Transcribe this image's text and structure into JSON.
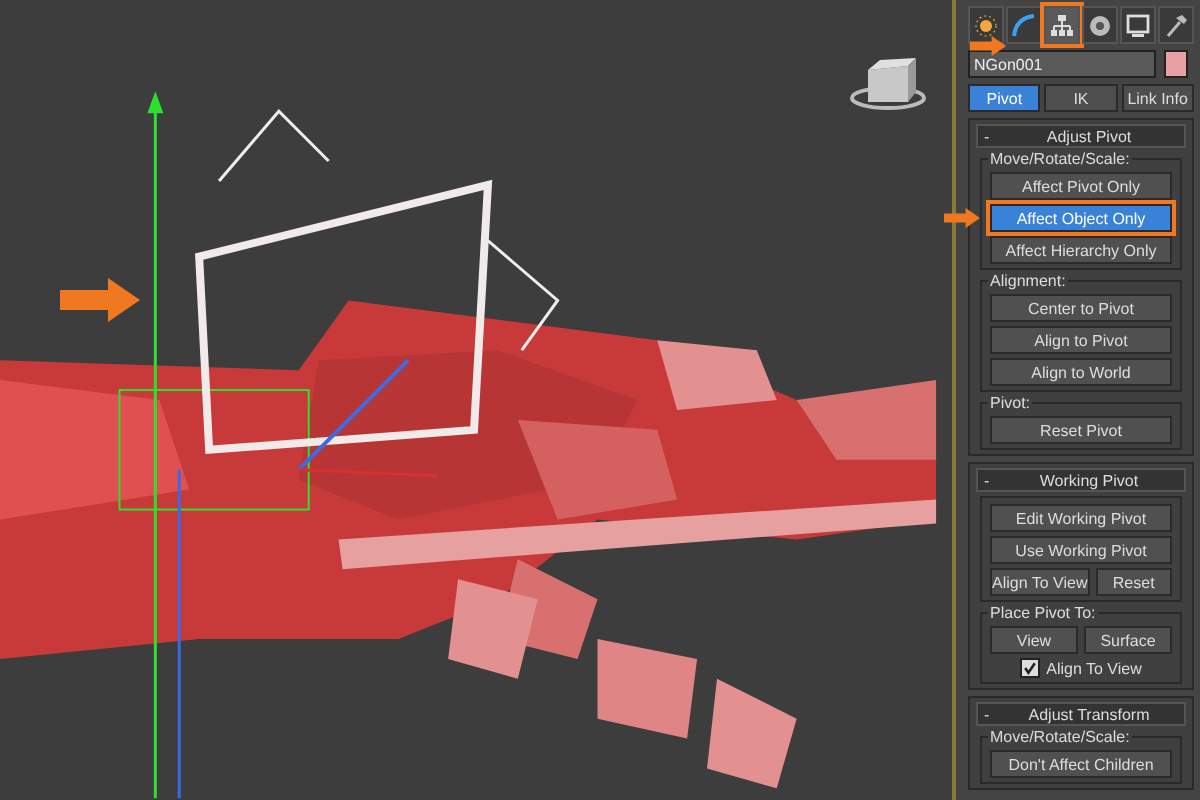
{
  "command_tabs": [
    {
      "kind": "light",
      "selected": false,
      "highlighted": false
    },
    {
      "kind": "curve",
      "selected": false,
      "highlighted": false
    },
    {
      "kind": "hierarchy",
      "selected": true,
      "highlighted": true
    },
    {
      "kind": "motion",
      "selected": false,
      "highlighted": false
    },
    {
      "kind": "display",
      "selected": false,
      "highlighted": false
    },
    {
      "kind": "hammer",
      "selected": false,
      "highlighted": false
    }
  ],
  "object_name": {
    "value": "NGon001",
    "color": "#e8a0a4"
  },
  "subtabs": [
    {
      "label": "Pivot",
      "selected": true
    },
    {
      "label": "IK",
      "selected": false
    },
    {
      "label": "Link Info",
      "selected": false
    }
  ],
  "rollouts": [
    {
      "toggle": "-",
      "title": "Adjust Pivot",
      "groups": [
        {
          "label": "Move/Rotate/Scale:",
          "rows": [
            [
              {
                "kind": "button",
                "label": "Affect Pivot Only",
                "selected": false,
                "highlighted": false
              }
            ],
            [
              {
                "kind": "button",
                "label": "Affect Object Only",
                "selected": true,
                "highlighted": true
              }
            ],
            [
              {
                "kind": "button",
                "label": "Affect Hierarchy Only",
                "selected": false,
                "highlighted": false
              }
            ]
          ]
        },
        {
          "label": "Alignment:",
          "rows": [
            [
              {
                "kind": "button",
                "label": "Center to Pivot"
              }
            ],
            [
              {
                "kind": "button",
                "label": "Align to Pivot"
              }
            ],
            [
              {
                "kind": "button",
                "label": "Align to World"
              }
            ]
          ]
        },
        {
          "label": "Pivot:",
          "rows": [
            [
              {
                "kind": "button",
                "label": "Reset Pivot"
              }
            ]
          ]
        }
      ]
    },
    {
      "toggle": "-",
      "title": "Working Pivot",
      "groups": [
        {
          "rows": [
            [
              {
                "kind": "button",
                "label": "Edit Working Pivot"
              }
            ],
            [
              {
                "kind": "button",
                "label": "Use Working Pivot"
              }
            ],
            [
              {
                "kind": "button",
                "label": "Align To View"
              },
              {
                "kind": "button",
                "label": "Reset"
              }
            ]
          ]
        },
        {
          "label": "Place Pivot To:",
          "rows": [
            [
              {
                "kind": "button",
                "label": "View"
              },
              {
                "kind": "button",
                "label": "Surface"
              }
            ],
            [
              {
                "kind": "checkbox",
                "label": "Align To View",
                "checked": true
              }
            ]
          ]
        }
      ]
    },
    {
      "toggle": "-",
      "title": "Adjust Transform",
      "groups": [
        {
          "label": "Move/Rotate/Scale:",
          "rows": [
            [
              {
                "kind": "button",
                "label": "Don't Affect Children"
              }
            ]
          ]
        }
      ]
    }
  ]
}
